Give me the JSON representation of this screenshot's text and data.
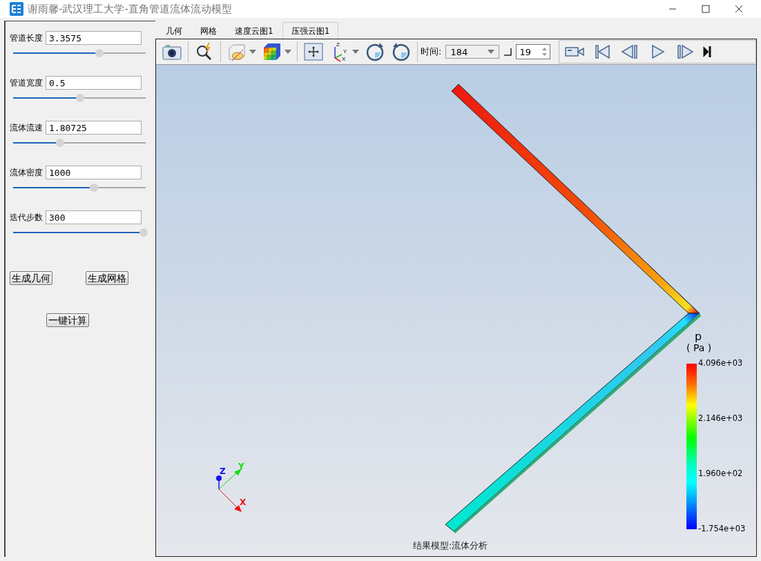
{
  "window": {
    "title": "谢雨馨-武汉理工大学-直角管道流体流动模型"
  },
  "parameters": [
    {
      "label": "管道长度",
      "value": "3.3575",
      "level": 0.65
    },
    {
      "label": "管道宽度",
      "value": "0.5",
      "level": 0.505
    },
    {
      "label": "流体流速",
      "value": "1.80725",
      "level": 0.355
    },
    {
      "label": "流体密度",
      "value": "1000",
      "level": 0.61
    },
    {
      "label": "迭代步数",
      "value": "300",
      "level": 0.985
    }
  ],
  "buttons": [
    "生成几何",
    "生成网格"
  ],
  "compute_button": "一键计算",
  "tabs": [
    {
      "label": "几何",
      "selected": false
    },
    {
      "label": "网格",
      "selected": false
    },
    {
      "label": "速度云图1",
      "selected": false
    },
    {
      "label": "压强云图1",
      "selected": true
    }
  ],
  "toolbar": {
    "axis_icon_labels": [
      "Z",
      "Y",
      "X"
    ],
    "time_label": "时间:",
    "time_value": "184",
    "frame_value": "19"
  },
  "legend": {
    "variable": "p",
    "unit": "( Pa )",
    "labels": [
      "4.096e+03",
      "2.146e+03",
      "1.960e+02",
      "-1.754e+03"
    ]
  },
  "axes": {
    "z": "Z",
    "y": "Y",
    "x": "X"
  },
  "caption": "结果模型:流体分析"
}
